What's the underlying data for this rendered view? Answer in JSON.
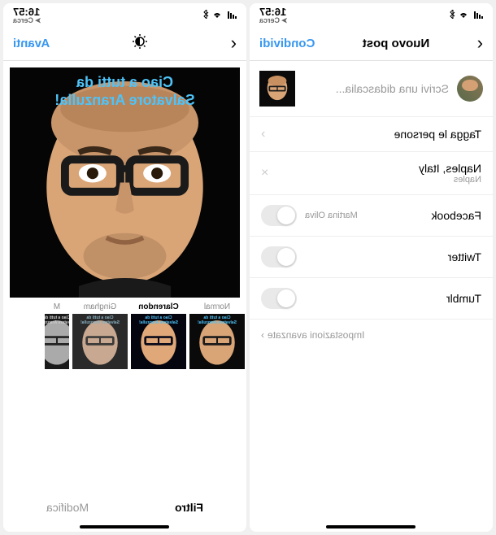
{
  "status": {
    "time": "16:57",
    "search_label": "Cerca"
  },
  "left": {
    "nav": {
      "title": "Nuovo post",
      "action": "Condividi"
    },
    "caption_placeholder": "Scrivi una didascalia...",
    "tag_people": "Tagga le persone",
    "location": {
      "name": "Naples, Italy",
      "sub": "Naples"
    },
    "share": {
      "facebook": {
        "label": "Facebook",
        "account": "Martina Oliva"
      },
      "twitter": {
        "label": "Twitter"
      },
      "tumblr": {
        "label": "Tumblr"
      }
    },
    "advanced": "Impostazioni avanzate"
  },
  "right": {
    "nav": {
      "action": "Avanti"
    },
    "overlay": {
      "line1": "Ciao a tutti da",
      "line2": "Salvatore Aranzulla!"
    },
    "filters": {
      "normal": "Normal",
      "clarendon": "Clarendon",
      "gingham": "Gingham",
      "moon": "M"
    },
    "tabs": {
      "filter": "Filtro",
      "edit": "Modifica"
    }
  }
}
